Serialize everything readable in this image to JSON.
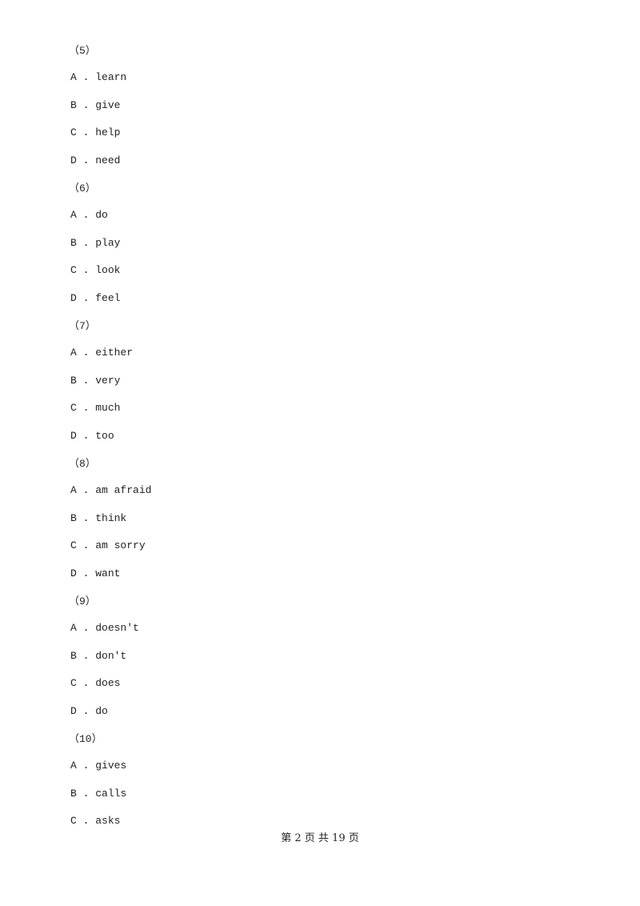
{
  "questions": [
    {
      "number": "（5）",
      "options": [
        {
          "letter": "A",
          "text": "learn"
        },
        {
          "letter": "B",
          "text": "give"
        },
        {
          "letter": "C",
          "text": "help"
        },
        {
          "letter": "D",
          "text": "need"
        }
      ]
    },
    {
      "number": "（6）",
      "options": [
        {
          "letter": "A",
          "text": "do"
        },
        {
          "letter": "B",
          "text": "play"
        },
        {
          "letter": "C",
          "text": "look"
        },
        {
          "letter": "D",
          "text": "feel"
        }
      ]
    },
    {
      "number": "（7）",
      "options": [
        {
          "letter": "A",
          "text": "either"
        },
        {
          "letter": "B",
          "text": "very"
        },
        {
          "letter": "C",
          "text": "much"
        },
        {
          "letter": "D",
          "text": "too"
        }
      ]
    },
    {
      "number": "（8）",
      "options": [
        {
          "letter": "A",
          "text": "am afraid"
        },
        {
          "letter": "B",
          "text": "think"
        },
        {
          "letter": "C",
          "text": "am sorry"
        },
        {
          "letter": "D",
          "text": "want"
        }
      ]
    },
    {
      "number": "（9）",
      "options": [
        {
          "letter": "A",
          "text": "doesn't"
        },
        {
          "letter": "B",
          "text": "don't"
        },
        {
          "letter": "C",
          "text": "does"
        },
        {
          "letter": "D",
          "text": "do"
        }
      ]
    },
    {
      "number": "（10）",
      "options": [
        {
          "letter": "A",
          "text": "gives"
        },
        {
          "letter": "B",
          "text": "calls"
        },
        {
          "letter": "C",
          "text": "asks"
        }
      ]
    }
  ],
  "footer": {
    "text": "第 2 页 共 19 页"
  }
}
